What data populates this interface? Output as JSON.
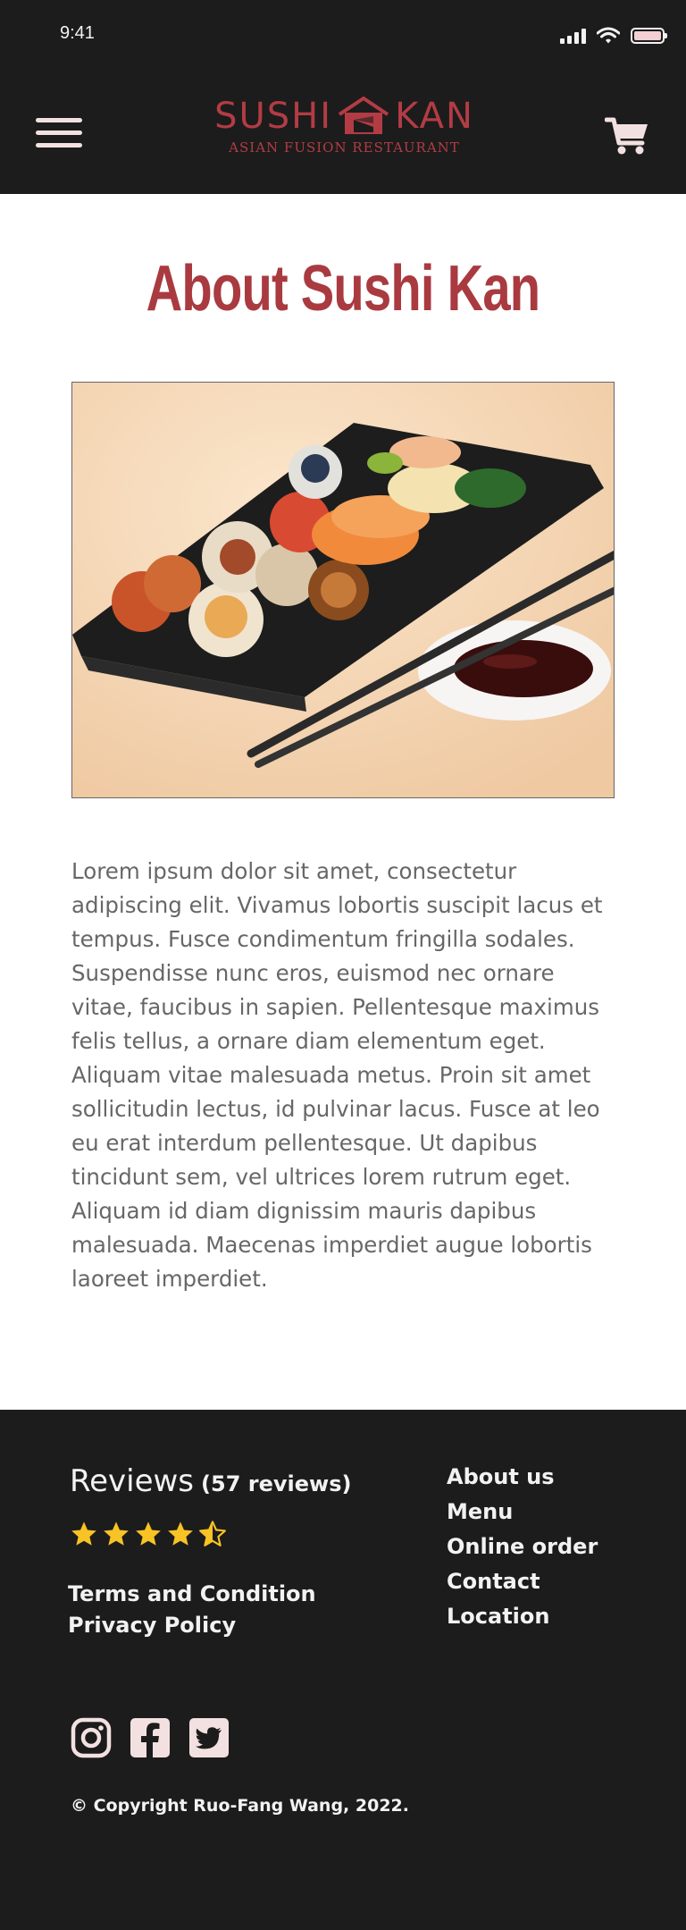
{
  "status_bar": {
    "time": "9:41"
  },
  "header": {
    "logo": {
      "title_left": "SUSHI",
      "title_right": "KAN",
      "subtitle": "ASIAN FUSION RESTAURANT"
    },
    "menu_icon": "hamburger-menu-icon",
    "cart_icon": "shopping-cart-icon"
  },
  "main": {
    "title": "About Sushi Kan",
    "image_subject": "sushi-platter-photo",
    "body": "Lorem ipsum dolor sit amet, consectetur adipiscing elit. Vivamus lobortis suscipit lacus et tempus. Fusce condimentum fringilla sodales. Suspendisse nunc eros, euismod nec ornare vitae, faucibus in sapien. Pellentesque maximus felis tellus, a ornare diam elementum eget. Aliquam vitae malesuada metus. Proin sit amet sollicitudin lectus, id pulvinar lacus. Fusce at leo eu erat interdum pellentesque. Ut dapibus tincidunt sem, vel ultrices lorem rutrum eget. Aliquam id diam dignissim mauris dapibus malesuada. Maecenas imperdiet augue lobortis laoreet imperdiet."
  },
  "footer": {
    "reviews_label": "Reviews",
    "reviews_count": "(57 reviews)",
    "rating": 4.5,
    "rating_max": 5,
    "legal_links": [
      "Terms and Condition",
      "Privacy Policy"
    ],
    "nav_links": [
      "About us",
      "Menu",
      "Online order",
      "Contact",
      "Location"
    ],
    "social": [
      "instagram-icon",
      "facebook-icon",
      "twitter-icon"
    ],
    "copyright": "© Copyright Ruo-Fang Wang, 2022."
  },
  "colors": {
    "header_bg": "#1c1c1c",
    "brand_red": "#b33c44",
    "title_red": "#a93a40",
    "star_yellow": "#f7c325",
    "body_text": "#676767"
  }
}
